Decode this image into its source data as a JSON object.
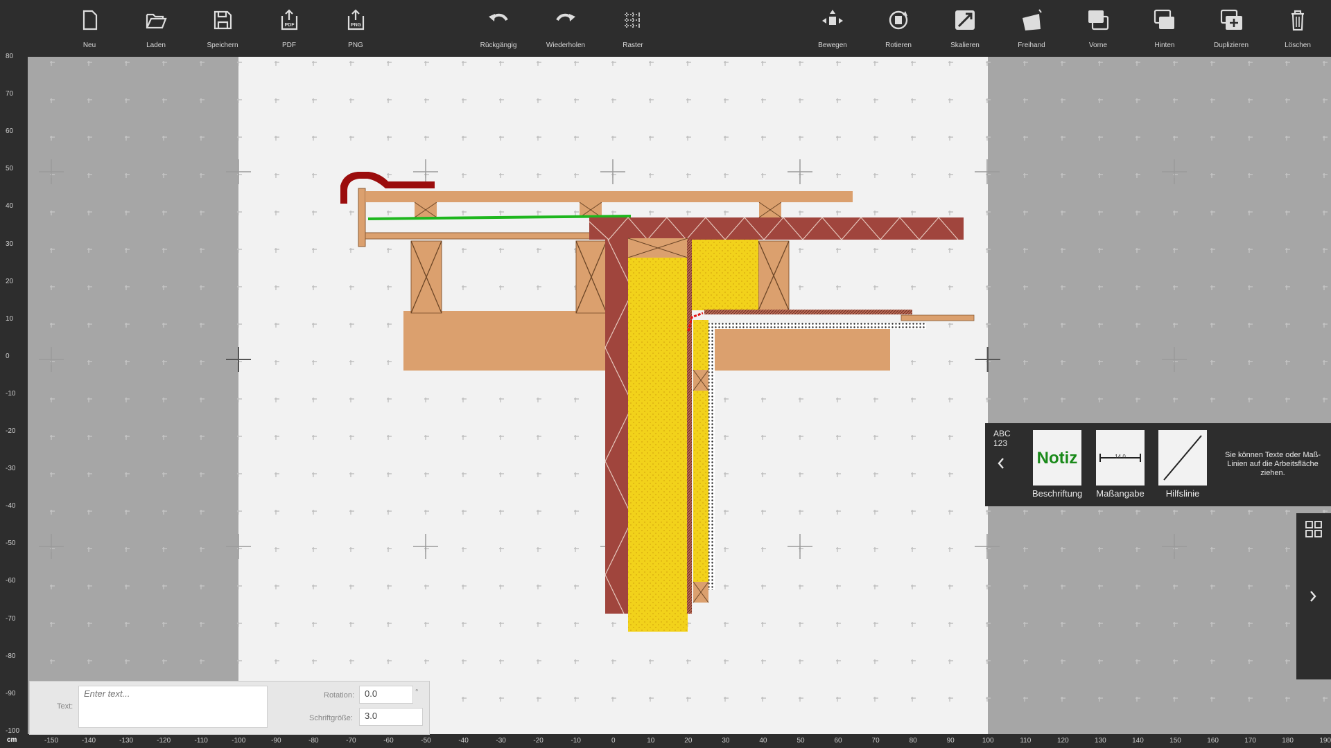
{
  "toolbar": {
    "left": [
      {
        "id": "new",
        "label": "Neu",
        "icon": "file-icon"
      },
      {
        "id": "load",
        "label": "Laden",
        "icon": "folder-open-icon"
      },
      {
        "id": "save",
        "label": "Speichern",
        "icon": "save-icon"
      },
      {
        "id": "pdf",
        "label": "PDF",
        "icon": "export-pdf-icon"
      },
      {
        "id": "png",
        "label": "PNG",
        "icon": "export-png-icon"
      }
    ],
    "middle": [
      {
        "id": "undo",
        "label": "Rückgängig",
        "icon": "undo-icon"
      },
      {
        "id": "redo",
        "label": "Wiederholen",
        "icon": "redo-icon"
      },
      {
        "id": "grid",
        "label": "Raster",
        "icon": "grid-icon"
      }
    ],
    "right": [
      {
        "id": "move",
        "label": "Bewegen",
        "icon": "move-icon"
      },
      {
        "id": "rotate",
        "label": "Rotieren",
        "icon": "rotate-icon"
      },
      {
        "id": "scale",
        "label": "Skalieren",
        "icon": "scale-icon"
      },
      {
        "id": "freehand",
        "label": "Freihand",
        "icon": "freehand-icon"
      },
      {
        "id": "front",
        "label": "Vorne",
        "icon": "bring-front-icon"
      },
      {
        "id": "back",
        "label": "Hinten",
        "icon": "send-back-icon"
      },
      {
        "id": "duplicate",
        "label": "Duplizieren",
        "icon": "duplicate-icon"
      },
      {
        "id": "delete",
        "label": "Löschen",
        "icon": "trash-icon"
      }
    ]
  },
  "ruler": {
    "unit": "cm",
    "vertical": [
      "80",
      "70",
      "60",
      "50",
      "40",
      "30",
      "20",
      "10",
      "0",
      "-10",
      "-20",
      "-30",
      "-40",
      "-50",
      "-60",
      "-70",
      "-80",
      "-90",
      "-100"
    ],
    "horizontal": [
      "-150",
      "-140",
      "-130",
      "-120",
      "-110",
      "-100",
      "-90",
      "-80",
      "-70",
      "-60",
      "-50",
      "-40",
      "-30",
      "-20",
      "-10",
      "0",
      "10",
      "20",
      "30",
      "40",
      "50",
      "60",
      "70",
      "80",
      "90",
      "100",
      "110",
      "120",
      "130",
      "140",
      "150",
      "160",
      "170",
      "180",
      "190"
    ]
  },
  "properties": {
    "text_label": "Text:",
    "text_placeholder": "Enter text...",
    "rotation_label": "Rotation:",
    "rotation_value": "0.0",
    "rotation_unit": "°",
    "fontsize_label": "Schriftgröße:",
    "fontsize_value": "3.0"
  },
  "palette": {
    "abc_label": "ABC",
    "num_label": "123",
    "back_icon": "chevron-left-icon",
    "items": [
      {
        "label": "Beschriftung",
        "thumb_text": "Notiz"
      },
      {
        "label": "Maßangabe",
        "thumb_text": "14.0"
      },
      {
        "label": "Hilfslinie",
        "thumb_text": ""
      }
    ],
    "hint": "Sie können Texte oder Maß-Linien auf die Arbeitsfläche ziehen."
  },
  "side_panel": {
    "icons": [
      "layout-grid-icon",
      "chevron-right-icon"
    ]
  },
  "colors": {
    "toolbar_bg": "#2d2d2d",
    "canvas_outer": "#a6a6a6",
    "canvas_page": "#f2f2f2",
    "wood": "#dba06e",
    "brick": "#a0453d",
    "insulation": "#f2d21b",
    "gutter": "#9b0d0d",
    "foil": "#1eb71e",
    "seal": "#e41414"
  }
}
